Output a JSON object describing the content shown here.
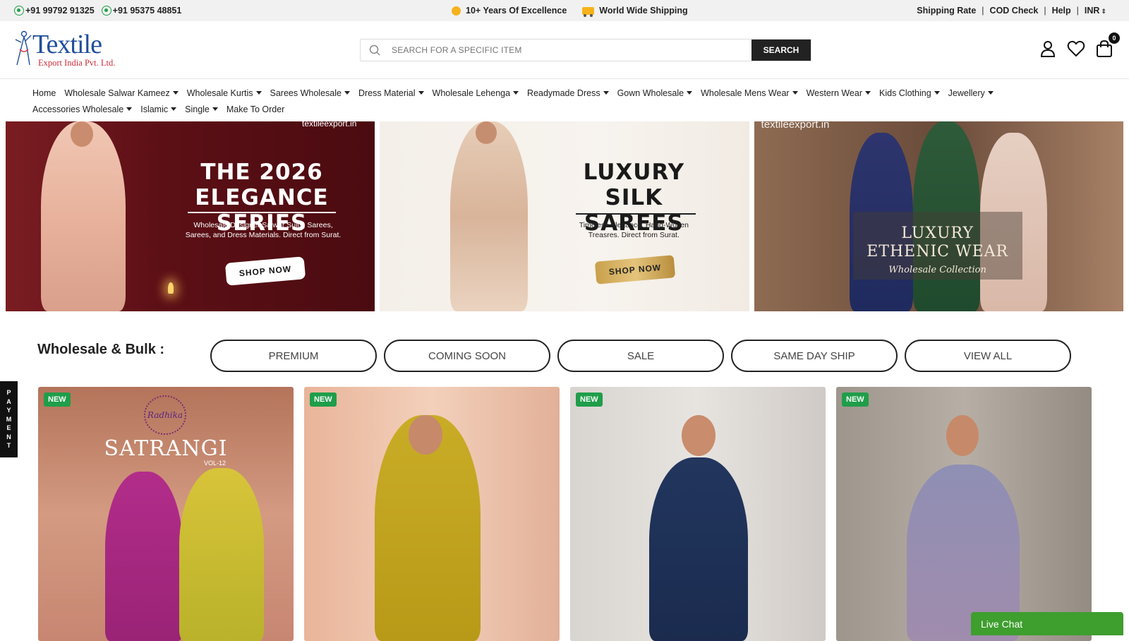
{
  "topbar": {
    "phones": [
      "+91 99792 91325",
      "+91 95375 48851"
    ],
    "promos": [
      "10+ Years Of Excellence",
      "World Wide Shipping"
    ],
    "links": [
      "Shipping Rate",
      "COD Check",
      "Help"
    ],
    "currency": "INR"
  },
  "header": {
    "logo_word": "Textile",
    "logo_sub": "Export India Pvt. Ltd.",
    "search_placeholder": "SEARCH FOR A SPECIFIC ITEM",
    "search_button": "SEARCH",
    "cart_count": "0"
  },
  "nav": {
    "row1": [
      {
        "label": "Home",
        "caret": false
      },
      {
        "label": "Wholesale Salwar Kameez",
        "caret": true
      },
      {
        "label": "Wholesale Kurtis",
        "caret": true
      },
      {
        "label": "Sarees Wholesale",
        "caret": true
      },
      {
        "label": "Dress Material",
        "caret": true
      },
      {
        "label": "Wholesale Lehenga",
        "caret": true
      },
      {
        "label": "Readymade Dress",
        "caret": true
      },
      {
        "label": "Gown Wholesale",
        "caret": true
      },
      {
        "label": "Wholesale Mens Wear",
        "caret": true
      },
      {
        "label": "Western Wear",
        "caret": true
      },
      {
        "label": "Kids Clothing",
        "caret": true
      },
      {
        "label": "Jewellery",
        "caret": true
      }
    ],
    "row2": [
      {
        "label": "Accessories Wholesale",
        "caret": true
      },
      {
        "label": "Islamic",
        "caret": true
      },
      {
        "label": "Single",
        "caret": true
      },
      {
        "label": "Make To Order",
        "caret": false
      }
    ]
  },
  "banners": {
    "b1": {
      "watermark": "textileexport.in",
      "title_line1": "THE 2026",
      "title_line2": "ELEGANCE SERIES",
      "desc": "Wholesale Designer Salwar Suits, Sarees, Sarees, and Dress Materials. Direct from Surat.",
      "cta": "SHOP NOW"
    },
    "b2": {
      "title_line1": "LUXURY",
      "title_line2": "SILK SAREES",
      "desc": "Timeless Elegance. Hand-Woven Treasres. Direct from Surat.",
      "cta": "SHOP NOW"
    },
    "b3": {
      "watermark": "textileexport.in",
      "title_line1": "LUXURY",
      "title_line2": "ETHENIC WEAR",
      "script": "Wholesale Collection"
    }
  },
  "wholesale": {
    "title": "Wholesale & Bulk :",
    "filters": [
      "PREMIUM",
      "COMING SOON",
      "SALE",
      "SAME DAY SHIP",
      "VIEW ALL"
    ]
  },
  "payment_tab": [
    "P",
    "A",
    "Y",
    "M",
    "E",
    "N",
    "T"
  ],
  "products": [
    {
      "badge": "NEW",
      "brand_logo": "Radhika",
      "brand_word": "SATRANGI",
      "brand_vol": "VOL-12"
    },
    {
      "badge": "NEW"
    },
    {
      "badge": "NEW"
    },
    {
      "badge": "NEW"
    }
  ],
  "livechat": "Live Chat",
  "colors": {
    "accent_green": "#1f9e4a",
    "logo_blue": "#1f4f9c",
    "logo_red": "#d12c3a",
    "chat_green": "#3e9e2e"
  }
}
